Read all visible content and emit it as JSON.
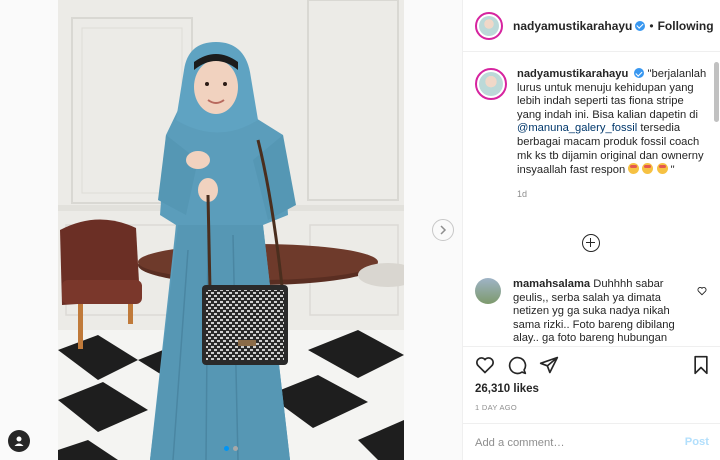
{
  "post": {
    "username": "nadyamustikarahayu",
    "follow_status": "Following",
    "dot": "•",
    "caption_text_1": "\"berjalanlah lurus untuk menuju kehidupan yang lebih indah seperti tas fiona stripe yang indah ini. Bisa kalian dapetin di",
    "caption_mention": "@manuna_galery_fossil",
    "caption_text_2": "tersedia berbagai macam produk fossil coach mk ks tb dijamin original dan ownerny insyaallah fast respon",
    "caption_end": "\"",
    "caption_time": "1d",
    "likes": "26,310 likes",
    "posted_ago": "1 DAY AGO"
  },
  "comment": {
    "username": "mamahsalama",
    "text": "Duhhhh sabar geulis,, serba salah ya dimata netizen yg ga suka nadya nikah sama rizki.. Foto bareng dibilang alay.. ga foto bareng hubungan"
  },
  "add_comment": {
    "placeholder": "Add a comment…",
    "post_label": "Post"
  },
  "colors": {
    "accent": "#0095f6",
    "verified": "#3897f0",
    "dress": "#5b9dbb",
    "post_disabled": "#b2dffc"
  },
  "icons": {
    "like": "heart-icon",
    "comment": "comment-icon",
    "share": "paper-plane-icon",
    "save": "bookmark-icon",
    "load_more": "plus-circle-icon",
    "next": "chevron-right-icon",
    "tags": "user-tag-icon"
  }
}
